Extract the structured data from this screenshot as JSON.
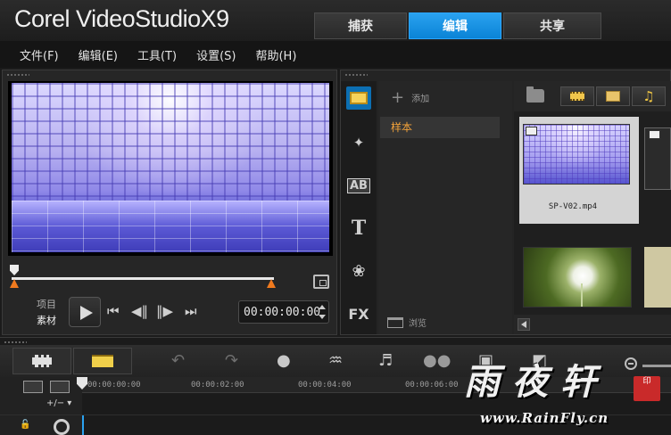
{
  "app": {
    "title_brand": "Corel",
    "title_product": "VideoStudio",
    "title_version": "X9"
  },
  "tabs": [
    {
      "label": "捕获",
      "active": false
    },
    {
      "label": "编辑",
      "active": true
    },
    {
      "label": "共享",
      "active": false
    }
  ],
  "menu": [
    "文件(F)",
    "编辑(E)",
    "工具(T)",
    "设置(S)",
    "帮助(H)"
  ],
  "player": {
    "mode_project": "项目",
    "mode_clip": "素材",
    "timecode": "00:00:00:00",
    "scrub_position": 0.0,
    "controls": {
      "home": "⏮",
      "prev": "◀‖",
      "next": "‖▶",
      "end": "⏭"
    }
  },
  "library": {
    "rail": {
      "title_icon": "AB",
      "text_icon": "T",
      "fx_icon": "FX",
      "transition_icon": "✦",
      "graphic_icon": "❀"
    },
    "add_label": "添加",
    "add_symbol": "+",
    "folders": [
      {
        "label": "样本",
        "selected": true
      }
    ],
    "browse_label": "浏览",
    "filters": [
      {
        "icon": "video-filter-icon"
      },
      {
        "icon": "photo-filter-icon"
      },
      {
        "icon": "audio-filter-icon",
        "glyph": "♫"
      }
    ],
    "thumbnails": [
      {
        "name": "SP-V02.mp4",
        "selected": true
      },
      {
        "name": "",
        "selected": false
      }
    ]
  },
  "timeline": {
    "tools": {
      "undo": "↶",
      "redo": "↷",
      "record": "●",
      "audio": "♒",
      "automusic": "♬",
      "motion": "●●",
      "subtitle": "▣",
      "split": "◩"
    },
    "ruler": [
      "00:00:00:00",
      "00:00:02:00",
      "00:00:04:00",
      "00:00:06:00"
    ],
    "add_remove": "+/− ▾",
    "lock_glyph": "🔓"
  },
  "watermark": {
    "logo_text": "雨夜轩",
    "seal": "印",
    "url": "www.RainFly.cn"
  },
  "colors": {
    "accent": "#0a83d6",
    "folder_selected": "#f2a23a",
    "marker": "#f07a1e"
  }
}
